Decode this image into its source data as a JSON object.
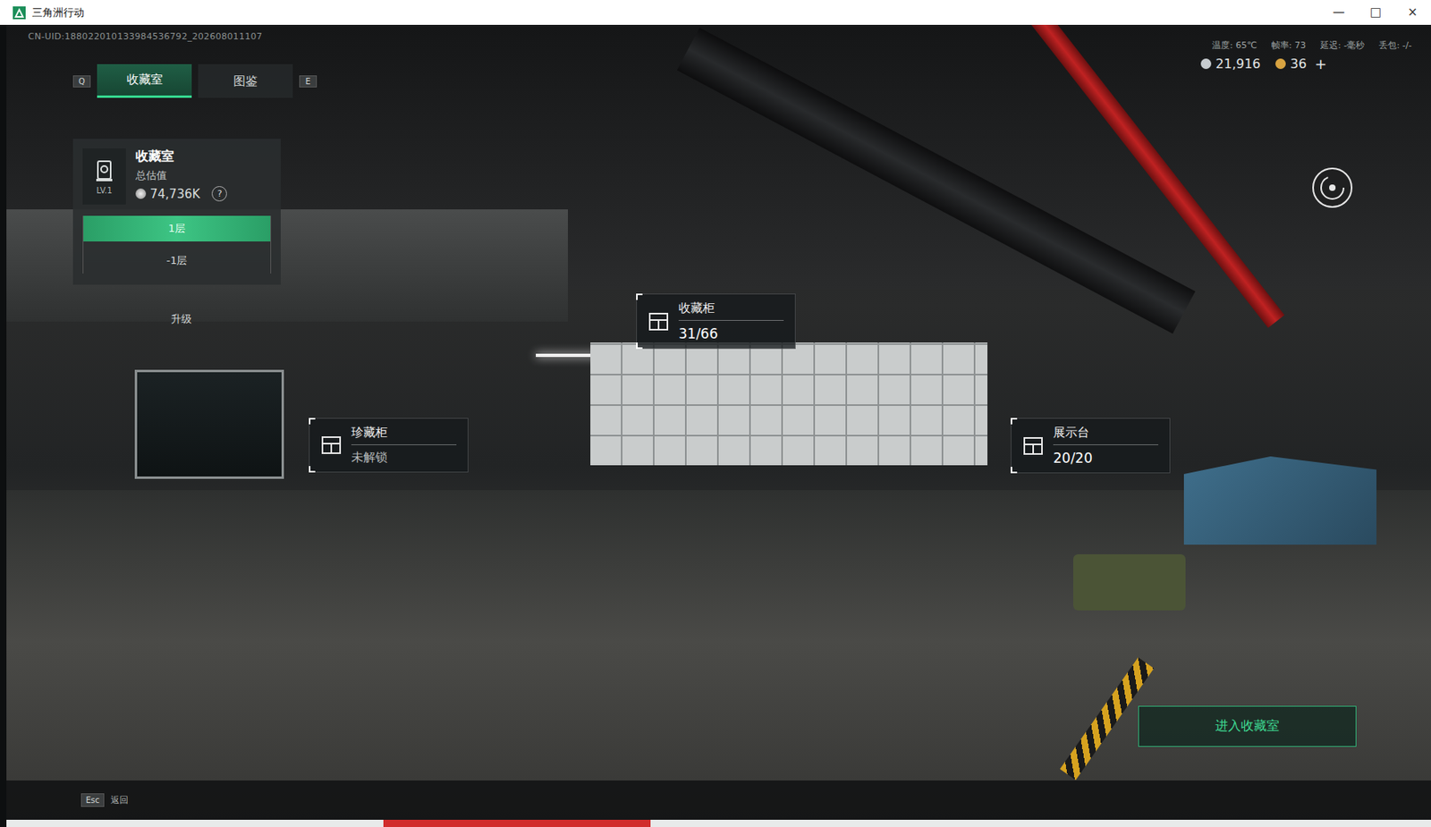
{
  "window": {
    "title": "三角洲行动",
    "controls": [
      "—",
      "□",
      "×"
    ]
  },
  "uid": "CN-UID:188022010133984536792_202608011107",
  "tabs": {
    "prev_key": "Q",
    "next_key": "E",
    "items": [
      {
        "label": "收藏室",
        "selected": true
      },
      {
        "label": "图鉴",
        "selected": false
      }
    ]
  },
  "stats": [
    {
      "label": "温度",
      "value": "65℃"
    },
    {
      "label": "帧率",
      "value": "73"
    },
    {
      "label": "延迟",
      "value": "-毫秒"
    },
    {
      "label": "丢包",
      "value": "-/-"
    }
  ],
  "currency": [
    {
      "value": "21,916",
      "color": "#c7ccd0"
    },
    {
      "value": "36",
      "color": "#d9a441"
    }
  ],
  "currency_add": "+",
  "collection_panel": {
    "title": "收藏室",
    "level": "LV.1",
    "value_label": "总估值",
    "value": "74,736K",
    "help": "?",
    "floors": [
      {
        "label": "1层",
        "selected": true
      },
      {
        "label": "-1层",
        "selected": false
      }
    ],
    "upgrade": "升级"
  },
  "hotspots": [
    {
      "name": "收藏柜",
      "value": "31/66",
      "locked": false
    },
    {
      "name": "珍藏柜",
      "value": "未解锁",
      "locked": true
    },
    {
      "name": "展示台",
      "value": "20/20",
      "locked": false
    }
  ],
  "enter_button": "进入收藏室",
  "footer": {
    "key": "Esc",
    "label": "返回"
  }
}
